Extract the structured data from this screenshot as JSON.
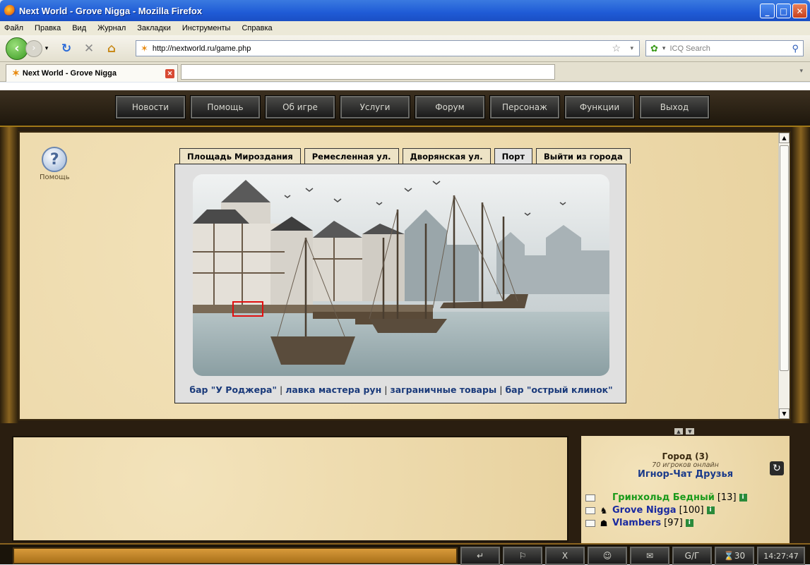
{
  "window": {
    "title": "Next World - Grove Nigga - Mozilla Firefox"
  },
  "menu": [
    "Файл",
    "Правка",
    "Вид",
    "Журнал",
    "Закладки",
    "Инструменты",
    "Справка"
  ],
  "address": {
    "url": "http://nextworld.ru/game.php"
  },
  "search": {
    "placeholder": "ICQ Search"
  },
  "tab": {
    "title": "Next World - Grove Nigga"
  },
  "game": {
    "nav": [
      "Новости",
      "Помощь",
      "Об игре",
      "Услуги",
      "Форум",
      "Персонаж",
      "Функции",
      "Выход"
    ],
    "help_label": "Помощь",
    "location_tabs": [
      "Площадь Мироздания",
      "Ремесленная ул.",
      "Дворянская ул.",
      "Порт",
      "Выйти из города"
    ],
    "active_tab": "Порт",
    "links": [
      "бар \"У Роджера\"",
      "лавка мастера рун",
      "заграничные товары",
      "бар \"острый клинок\""
    ],
    "users_panel": {
      "title": "Город (3)",
      "online": "70 игроков онлайн",
      "friends": "Игнор-Чат Друзья",
      "users": [
        {
          "name": "Гринхольд Бедный",
          "level": "[13]",
          "color": "#1a9a1a"
        },
        {
          "name": "Grove Nigga",
          "level": "[100]",
          "color": "#1a2aa0"
        },
        {
          "name": "Vlambers",
          "level": "[97]",
          "color": "#1a2aa0"
        }
      ]
    },
    "toolbar": {
      "buttons": [
        "↵",
        "⚐",
        "X",
        "☺",
        "✉",
        "G/Г",
        "⌛30"
      ],
      "clock": "14:27:47"
    }
  }
}
